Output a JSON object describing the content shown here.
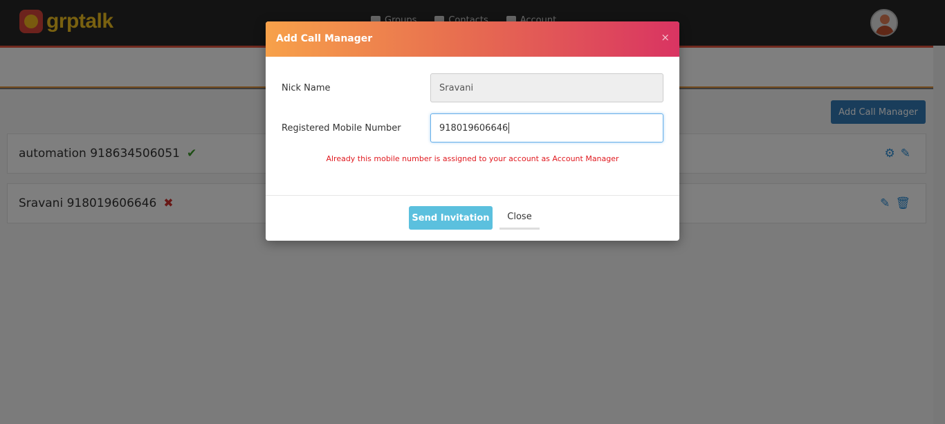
{
  "app": {
    "logo_text": "grptalk"
  },
  "nav": {
    "items": [
      {
        "label": "Groups",
        "icon": "group-icon"
      },
      {
        "label": "Contacts",
        "icon": "contacts-icon"
      },
      {
        "label": "Account",
        "icon": "user-icon"
      }
    ]
  },
  "page": {
    "add_button_label": "Add Call Manager",
    "managers": [
      {
        "name": "automation 918634506051",
        "status_icon": "check-icon",
        "actions": [
          "settings-icon",
          "edit-icon"
        ]
      },
      {
        "name": "Sravani 918019606646",
        "status_icon": "cross-icon",
        "actions": [
          "edit-icon",
          "trash-icon"
        ]
      }
    ]
  },
  "modal": {
    "title": "Add Call Manager",
    "close_symbol": "×",
    "fields": {
      "nick_name": {
        "label": "Nick Name",
        "value": "Sravani"
      },
      "mobile": {
        "label": "Registered Mobile Number",
        "value": "918019606646"
      }
    },
    "error_message": "Already this mobile number is assigned to your account as Account Manager",
    "send_label": "Send Invitation",
    "close_label": "Close"
  },
  "colors": {
    "header_gradient_start": "#f7a14a",
    "header_gradient_end": "#d93462",
    "primary": "#337ab7",
    "info": "#5bc0de",
    "error": "#e0191f",
    "logo": "#f2c321"
  }
}
